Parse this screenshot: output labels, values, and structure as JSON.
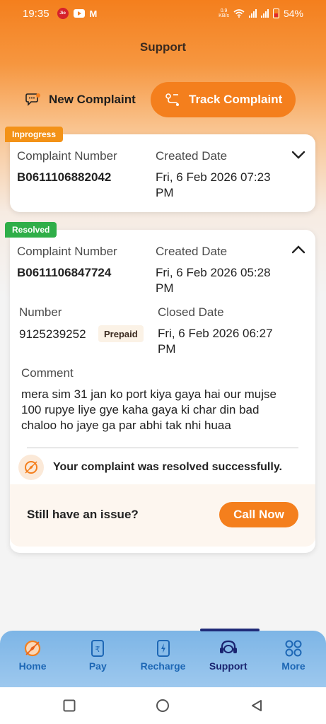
{
  "status_bar": {
    "time": "19:35",
    "jio_label": "Jio",
    "mail_glyph": "M",
    "net_speed_value": "0.9",
    "net_speed_unit": "KB/s",
    "battery": "54%"
  },
  "header": {
    "title": "Support"
  },
  "tabs": {
    "new_complaint": "New Complaint",
    "track_complaint": "Track Complaint",
    "active": "track_complaint"
  },
  "complaints": [
    {
      "status": "Inprogress",
      "complaint_number_label": "Complaint Number",
      "complaint_number": "B0611106882042",
      "created_date_label": "Created Date",
      "created_date": "Fri, 6 Feb 2026 07:23 PM",
      "expanded": false
    },
    {
      "status": "Resolved",
      "complaint_number_label": "Complaint Number",
      "complaint_number": "B0611106847724",
      "created_date_label": "Created Date",
      "created_date": "Fri, 6 Feb 2026 05:28 PM",
      "number_label": "Number",
      "number": "9125239252",
      "plan_type": "Prepaid",
      "closed_date_label": "Closed Date",
      "closed_date": "Fri, 6 Feb 2026 06:27 PM",
      "comment_label": "Comment",
      "comment": "mera sim 31 jan ko port kiya gaya hai our mujse 100 rupye liye gye kaha gaya ki char din bad chaloo ho jaye ga par abhi tak nhi huaa",
      "resolution_message": "Your complaint was resolved successfully.",
      "issue_prompt": "Still have an issue?",
      "call_button": "Call Now",
      "expanded": true
    }
  ],
  "bottom_nav": {
    "items": [
      {
        "label": "Home",
        "icon": "compass-icon"
      },
      {
        "label": "Pay",
        "icon": "rupee-card-icon"
      },
      {
        "label": "Recharge",
        "icon": "lightning-card-icon"
      },
      {
        "label": "Support",
        "icon": "headset-icon"
      },
      {
        "label": "More",
        "icon": "grid-icon"
      }
    ],
    "active": "Support"
  },
  "colors": {
    "accent": "#f47f1d",
    "inprogress": "#f39217",
    "resolved": "#2fae48",
    "nav_background": "#8dbeea",
    "nav_active": "#1a2470"
  }
}
